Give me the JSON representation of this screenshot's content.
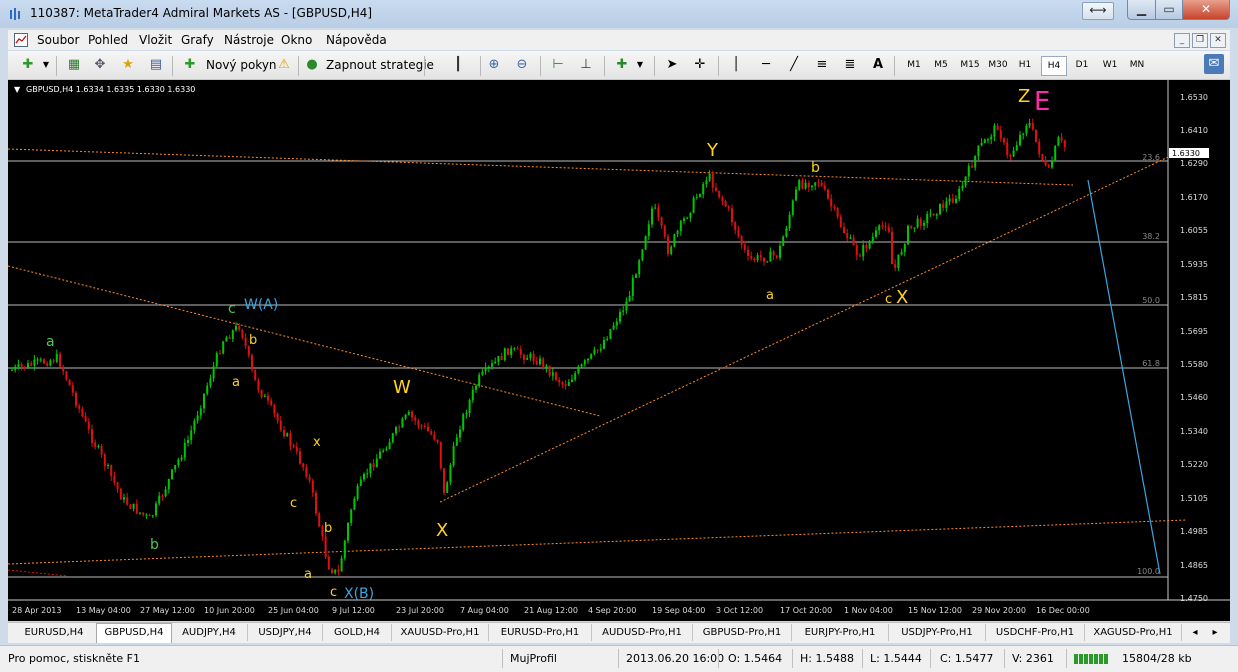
{
  "window": {
    "title": "110387: MetaTrader4 Admiral Markets AS - [GBPUSD,H4]"
  },
  "menu": [
    "Soubor",
    "Pohled",
    "Vložit",
    "Grafy",
    "Nástroje",
    "Okno",
    "Nápověda"
  ],
  "toolbar": {
    "new_order": "Nový pokyn",
    "autotrading": "Zapnout strategie",
    "text_tool": "A",
    "timeframes": [
      "M1",
      "M5",
      "M15",
      "M30",
      "H1",
      "H4",
      "D1",
      "W1",
      "MN"
    ],
    "active_timeframe": "H4"
  },
  "chart": {
    "header": "GBPUSD,H4  1.6334 1.6335 1.6330 1.6330",
    "current_price": "1.6330",
    "price_ticks": [
      "1.6530",
      "1.6410",
      "1.6290",
      "1.6170",
      "1.6055",
      "1.5935",
      "1.5815",
      "1.5695",
      "1.5580",
      "1.5460",
      "1.5340",
      "1.5220",
      "1.5105",
      "1.4985",
      "1.4865",
      "1.4750"
    ],
    "date_ticks": [
      "28 Apr 2013",
      "13 May 04:00",
      "27 May 12:00",
      "10 Jun 20:00",
      "25 Jun 04:00",
      "9 Jul 12:00",
      "23 Jul 20:00",
      "7 Aug 04:00",
      "21 Aug 12:00",
      "4 Sep 20:00",
      "19 Sep 04:00",
      "3 Oct 12:00",
      "17 Oct 20:00",
      "1 Nov 04:00",
      "15 Nov 12:00",
      "29 Nov 20:00",
      "16 Dec 00:00"
    ],
    "fib_levels": [
      "23.6",
      "38.2",
      "50.0",
      "61.8",
      "100.0"
    ],
    "wave_labels": [
      {
        "text": "a",
        "color": "#4ec94e"
      },
      {
        "text": "b",
        "color": "#4ec94e"
      },
      {
        "text": "c",
        "color": "#4ec94e"
      },
      {
        "text": "W(A)",
        "color": "#3aa6e0"
      },
      {
        "text": "b",
        "color": "#ffd21f"
      },
      {
        "text": "a",
        "color": "#ffd21f"
      },
      {
        "text": "x",
        "color": "#ffd21f"
      },
      {
        "text": "c",
        "color": "#ffd21f"
      },
      {
        "text": "b",
        "color": "#ffd21f"
      },
      {
        "text": "a",
        "color": "#ffd21f"
      },
      {
        "text": "c",
        "color": "#ffd21f"
      },
      {
        "text": "X(B)",
        "color": "#3aa6e0"
      },
      {
        "text": "W",
        "color": "#ffd21f"
      },
      {
        "text": "X",
        "color": "#ffd21f"
      },
      {
        "text": "Y",
        "color": "#ffd21f"
      },
      {
        "text": "a",
        "color": "#ffd21f"
      },
      {
        "text": "b",
        "color": "#ffd21f"
      },
      {
        "text": "c",
        "color": "#ffd21f"
      },
      {
        "text": "X",
        "color": "#ffd21f"
      },
      {
        "text": "Z",
        "color": "#ffd21f"
      },
      {
        "text": "E",
        "color": "#ff2aa8"
      }
    ]
  },
  "tabs": [
    "EURUSD,H4",
    "GBPUSD,H4",
    "AUDJPY,H4",
    "USDJPY,H4",
    "GOLD,H4",
    "XAUUSD-Pro,H1",
    "EURUSD-Pro,H1",
    "AUDUSD-Pro,H1",
    "GBPUSD-Pro,H1",
    "EURJPY-Pro,H1",
    "USDJPY-Pro,H1",
    "USDCHF-Pro,H1",
    "XAGUSD-Pro,H1"
  ],
  "active_tab": "GBPUSD,H4",
  "status": {
    "help": "Pro pomoc, stiskněte F1",
    "profile": "MujProfil",
    "datetime": "2013.06.20 16:00",
    "open": "O: 1.5464",
    "high": "H: 1.5488",
    "low": "L: 1.5444",
    "close": "C: 1.5477",
    "volume": "V: 2361",
    "traffic": "15804/28 kb"
  },
  "colors": {
    "bull": "#00c800",
    "bear": "#e01010",
    "fib": "#c8c8c8",
    "trend": "#ff8c28",
    "blue_line": "#3aa6e0"
  }
}
